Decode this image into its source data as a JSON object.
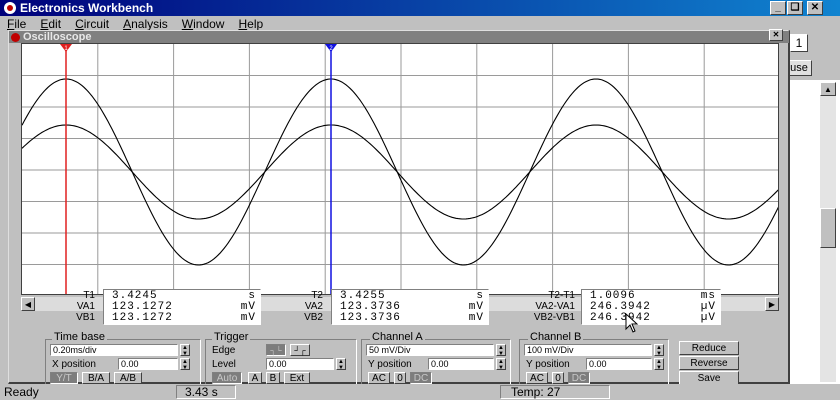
{
  "app": {
    "title": "Electronics Workbench",
    "accent": "#00007b"
  },
  "menu": [
    "File",
    "Edit",
    "Circuit",
    "Analysis",
    "Window",
    "Help"
  ],
  "menu_underline": [
    "F",
    "E",
    "C",
    "A",
    "W",
    "H"
  ],
  "window_buttons": {
    "minimize": "_",
    "restore": "❏",
    "close": "✕"
  },
  "background": {
    "pause_label": "use",
    "side_number": "1"
  },
  "oscilloscope": {
    "title": "Oscilloscope",
    "cursor1_label": "1",
    "cursor2_label": "2",
    "cursor1_color": "#e02020",
    "cursor2_color": "#1010e0",
    "readout": {
      "t1": {
        "label": "T1",
        "value": "3.4245",
        "unit": "s"
      },
      "va1": {
        "label": "VA1",
        "value": "123.1272",
        "unit": "mV"
      },
      "vb1": {
        "label": "VB1",
        "value": "123.1272",
        "unit": "mV"
      },
      "t2": {
        "label": "T2",
        "value": "3.4255",
        "unit": "s"
      },
      "va2": {
        "label": "VA2",
        "value": "123.3736",
        "unit": "mV"
      },
      "vb2": {
        "label": "VB2",
        "value": "123.3736",
        "unit": "mV"
      },
      "dt": {
        "label": "T2-T1",
        "value": "1.0096",
        "unit": "ms"
      },
      "dva": {
        "label": "VA2-VA1",
        "value": "246.3942",
        "unit": "µV"
      },
      "dvb": {
        "label": "VB2-VB1",
        "value": "246.3942",
        "unit": "µV"
      }
    },
    "timebase": {
      "title": "Time base",
      "scale": "0.20ms/div",
      "xpos_label": "X position",
      "xpos": "0.00",
      "modes": [
        "Y/T",
        "B/A",
        "A/B"
      ]
    },
    "trigger": {
      "title": "Trigger",
      "edge_label": "Edge",
      "edge_rise": "┐└",
      "edge_fall": "┘┌",
      "level_label": "Level",
      "level": "0.00",
      "sources": [
        "Auto",
        "A",
        "B",
        "Ext"
      ]
    },
    "channel_a": {
      "title": "Channel A",
      "scale": "50 mV/Div",
      "ypos_label": "Y position",
      "ypos": "0.00",
      "coupling": [
        "AC",
        "0",
        "DC"
      ]
    },
    "channel_b": {
      "title": "Channel B",
      "scale": "100 mV/Div",
      "ypos_label": "Y position",
      "ypos": "0.00",
      "coupling": [
        "AC",
        "0",
        "DC"
      ]
    },
    "actions": [
      "Reduce",
      "Reverse",
      "Save"
    ]
  },
  "status": {
    "ready": "Ready",
    "time": "3.43 s",
    "temp": "Temp:  27"
  }
}
